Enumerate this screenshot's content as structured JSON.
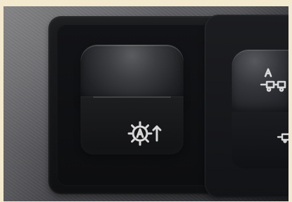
{
  "scene": {
    "colors": {
      "background": "#f2e9cf",
      "panel": "#4f4f54",
      "switch_dark": "#141518",
      "icon": "#d9d9d9"
    }
  },
  "left_switch": {
    "icon": "auto-gear-up-icon"
  },
  "right_switch": {
    "top_icon": "trailer-a-icon",
    "bottom_icon": "trailer-partial-icon"
  }
}
